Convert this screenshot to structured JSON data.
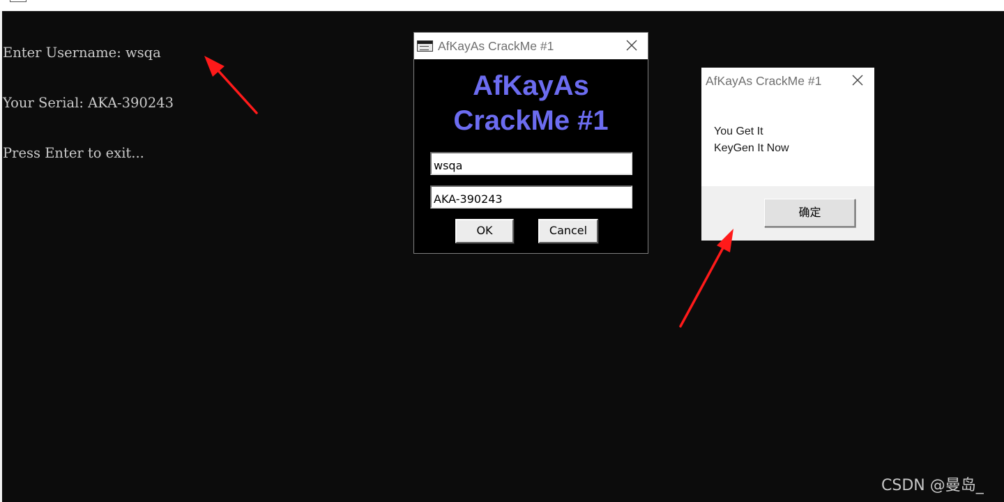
{
  "console": {
    "lines": [
      "Enter Username: wsqa",
      "Your Serial: AKA-390243",
      "Press Enter to exit..."
    ]
  },
  "crackme_window": {
    "title": "AfKayAs CrackMe #1",
    "heading_line1": "AfKayAs",
    "heading_line2": "CrackMe #1",
    "username_value": "wsqa",
    "serial_value": "AKA-390243",
    "ok_label": "OK",
    "cancel_label": "Cancel",
    "heading_color": "#6c6cf0",
    "background_color": "#000000"
  },
  "message_box": {
    "title": "AfKayAs CrackMe #1",
    "line1": "You Get It",
    "line2": "KeyGen It Now",
    "confirm_label": "确定"
  },
  "annotation_color": "#ff1a1a",
  "watermark": "CSDN @曼岛_",
  "icons": [
    "app-window-icon",
    "close-icon",
    "red-arrow-annotation"
  ]
}
